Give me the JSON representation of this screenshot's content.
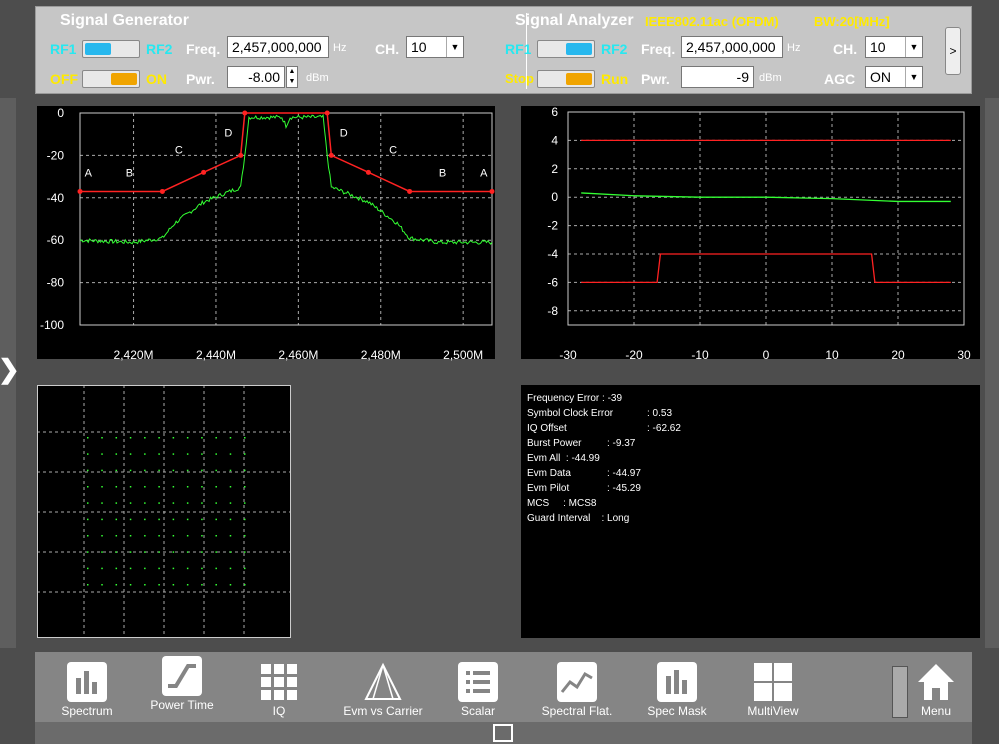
{
  "signal_generator": {
    "title": "Signal Generator",
    "rf1": "RF1",
    "rf2": "RF2",
    "off": "OFF",
    "on": "ON",
    "freq_label": "Freq.",
    "freq_value": "2,457,000,000",
    "freq_unit": "Hz",
    "pwr_label": "Pwr.",
    "pwr_value": "-8.00",
    "pwr_unit": "dBm",
    "ch_label": "CH.",
    "ch_value": "10"
  },
  "signal_analyzer": {
    "title": "Signal Analyzer",
    "standard": "IEEE802.11ac (OFDM)",
    "bw": "BW:20[MHz]",
    "rf1": "RF1",
    "rf2": "RF2",
    "stop": "Stop",
    "run": "Run",
    "freq_label": "Freq.",
    "freq_value": "2,457,000,000",
    "freq_unit": "Hz",
    "pwr_label": "Pwr.",
    "pwr_value": "-9",
    "pwr_unit": "dBm",
    "ch_label": "CH.",
    "ch_value": "10",
    "agc_label": "AGC",
    "agc_value": "ON",
    "more_label": ">"
  },
  "colors": {
    "trace": "#33ff33",
    "mask": "#ff2222",
    "accent_cyan": "#27e8f0",
    "accent_yellow": "#ffea00"
  },
  "chart_data": [
    {
      "type": "line",
      "y_ticks": [
        "0",
        "-20",
        "-40",
        "-60",
        "-80",
        "-100"
      ],
      "x_ticks": [
        "2,420M",
        "2,440M",
        "2,460M",
        "2,480M",
        "2,500M"
      ],
      "xlim": [
        2407,
        2507
      ],
      "ylim": [
        -100,
        0
      ],
      "mask_labels": [
        "A",
        "B",
        "C",
        "D",
        "D",
        "C",
        "B",
        "A"
      ],
      "series": [
        {
          "values_x": [
            2407,
            2427,
            2437,
            2446,
            2447,
            2467,
            2468,
            2477,
            2487,
            2507
          ],
          "values_y": [
            -37,
            -37,
            -28,
            -20,
            0,
            0,
            -20,
            -28,
            -37,
            -37
          ]
        },
        {
          "values_x": [
            2407,
            2420,
            2427,
            2430,
            2437,
            2442,
            2446,
            2447,
            2448,
            2456,
            2457,
            2458,
            2466,
            2467,
            2468,
            2472,
            2477,
            2484,
            2487,
            2494,
            2507
          ],
          "values_y": [
            -60,
            -61,
            -59,
            -52,
            -42,
            -38,
            -35,
            -20,
            -2,
            -2,
            -6,
            -2,
            -2,
            -20,
            -35,
            -38,
            -42,
            -52,
            -59,
            -61,
            -61
          ]
        }
      ]
    },
    {
      "type": "line",
      "y_ticks": [
        "6",
        "4",
        "2",
        "0",
        "-2",
        "-4",
        "-6",
        "-8"
      ],
      "x_ticks": [
        "-30",
        "-20",
        "-10",
        "0",
        "10",
        "20",
        "30"
      ],
      "xlim": [
        -30,
        30
      ],
      "ylim": [
        -9,
        6
      ],
      "series": [
        {
          "values_x": [
            -28,
            28
          ],
          "values_y": [
            4,
            4
          ]
        },
        {
          "values_x": [
            -28,
            -16.5,
            -16,
            16,
            16.5,
            28
          ],
          "values_y": [
            -6,
            -6,
            -4,
            -4,
            -6,
            -6
          ]
        },
        {
          "values_x": [
            -28,
            -20,
            -10,
            0,
            10,
            20,
            28
          ],
          "values_y": [
            0.3,
            0.1,
            0,
            0,
            -0.1,
            -0.3,
            -0.3
          ]
        }
      ]
    },
    {
      "type": "scatter",
      "constellation_rows": 10,
      "constellation_cols": 12
    }
  ],
  "info": {
    "freq_err": "Frequency Error : -39",
    "sym_clk_lbl": "Symbol Clock Error",
    "sym_clk_val": ": 0.53",
    "iq_lbl": "IQ Offset",
    "iq_val": ": -62.62",
    "burst_lbl": "Burst Power",
    "burst_val": ": -9.37",
    "evm_all": "Evm All  : -44.99",
    "evm_data_lbl": "Evm Data",
    "evm_data_val": ": -44.97",
    "evm_pilot_lbl": "Evm Pilot",
    "evm_pilot_val": ": -45.29",
    "mcs": "MCS     : MCS8",
    "guard": "Guard Interval    : Long"
  },
  "toolbar": {
    "spectrum": "Spectrum",
    "power_time": "Power Time",
    "iq": "IQ",
    "evm_carrier": "Evm vs Carrier",
    "scalar": "Scalar",
    "spectral_flat": "Spectral Flat.",
    "spec_mask": "Spec Mask",
    "multiview": "MultiView",
    "menu": "Menu"
  }
}
